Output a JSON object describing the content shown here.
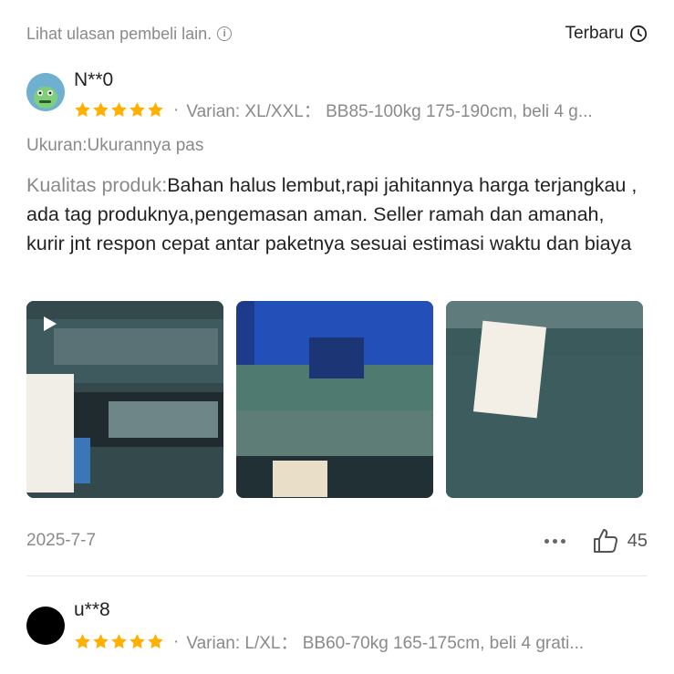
{
  "header": {
    "hint": "Lihat ulasan pembeli lain.",
    "info_icon": "info-icon",
    "sort_label": "Terbaru",
    "sort_icon": "clock-icon"
  },
  "colors": {
    "star": "#FFB000",
    "muted": "#8a8a8a"
  },
  "reviews": [
    {
      "user": "N**0",
      "rating": 5,
      "variant": "Varian: XL/XXL： BB85-100kg 175-190cm, beli 4 g...",
      "size_label": "Ukuran:Ukurannya pas",
      "quality_label": "Kualitas produk:",
      "quality_text": "Bahan halus lembut,rapi jahitannya harga terjangkau , ada tag produknya,pengemasan aman. Seller ramah dan amanah, kurir jnt respon cepat antar paketnya sesuai estimasi waktu dan biaya",
      "date": "2025-7-7",
      "likes": "45"
    },
    {
      "user": "u**8",
      "rating": 5,
      "variant": "Varian: L/XL： BB60-70kg 165-175cm, beli 4 grati..."
    }
  ]
}
